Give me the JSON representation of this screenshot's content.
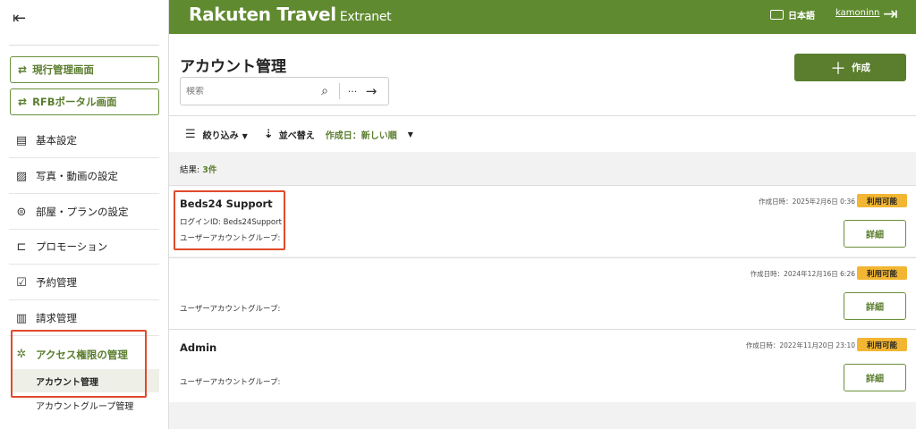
{
  "app": {
    "logo_main": "Rakuten Travel",
    "logo_sub": "Extranet",
    "language": "日本語",
    "username": "kamoninn"
  },
  "sidebar": {
    "current_screen_button": "現行管理画面",
    "rfb_portal_button": "RFBポータル画面",
    "items": [
      {
        "label": "基本設定",
        "icon": "document-settings-icon"
      },
      {
        "label": "写真・動画の設定",
        "icon": "image-icon"
      },
      {
        "label": "部屋・プランの設定",
        "icon": "toggle-icon"
      },
      {
        "label": "プロモーション",
        "icon": "ticket-icon"
      },
      {
        "label": "予約管理",
        "icon": "calendar-check-icon"
      },
      {
        "label": "請求管理",
        "icon": "invoice-icon"
      }
    ],
    "active_section": {
      "label": "アクセス権限の管理",
      "icon": "network-icon"
    },
    "sub_items": [
      {
        "label": "アカウント管理",
        "selected": true
      },
      {
        "label": "アカウントグループ管理",
        "selected": false
      }
    ]
  },
  "main": {
    "title": "アカウント管理",
    "search_placeholder": "検索",
    "create_button": "作成",
    "filter_label": "絞り込み",
    "sort_label": "並べ替え",
    "sort_value": "作成日：新しい順",
    "results_prefix": "結果: ",
    "results_count": "3件",
    "accounts": [
      {
        "name": "Beds24 Support",
        "login_id": "ログインID: Beds24Support",
        "group": "ユーザーアカウントグループ:",
        "created": "作成日時：2025年2月6日 0:36",
        "status": "利用可能",
        "detail": "詳細"
      },
      {
        "name": "",
        "login_id": "",
        "group": "ユーザーアカウントグループ:",
        "created": "作成日時：2024年12月16日 6:26",
        "status": "利用可能",
        "detail": "詳細"
      },
      {
        "name": "Admin",
        "login_id": "",
        "group": "ユーザーアカウントグループ:",
        "created": "作成日時：2022年11月20日 23:10",
        "status": "利用可能",
        "detail": "詳細"
      }
    ]
  },
  "colors": {
    "brand_green": "#5f8a2f",
    "button_green": "#5a7d2e",
    "badge_yellow": "#f2b632",
    "highlight_red": "#e04a2b"
  }
}
